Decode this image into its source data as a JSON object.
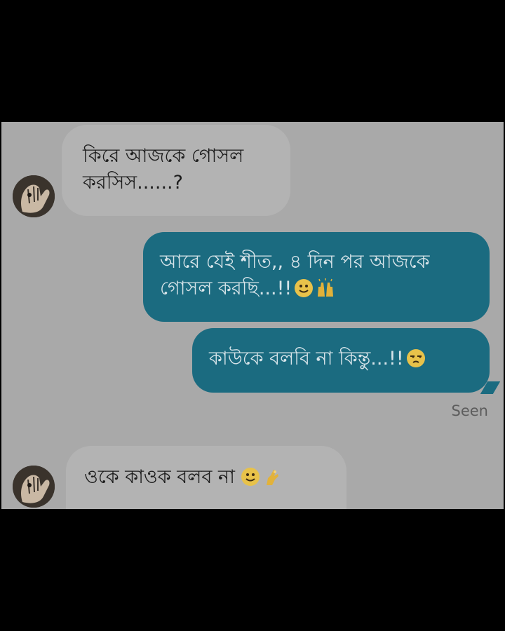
{
  "conversation": {
    "messages": [
      {
        "direction": "incoming",
        "text": "কিরে আজকে গোসল করসিস......?"
      },
      {
        "direction": "outgoing",
        "text": "আরে যেই শীত,, ৪ দিন পর আজকে গোসল করছি...!!",
        "emojis": [
          "slightly-smiling-face-icon",
          "raised-hands-icon"
        ]
      },
      {
        "direction": "outgoing",
        "text": "কাউকে বলবি না কিন্তু...!!",
        "emojis": [
          "unamused-face-icon"
        ]
      },
      {
        "direction": "incoming",
        "text": "ওকে কাওক বলব না",
        "emojis": [
          "slightly-smiling-face-icon",
          "pinching-hand-icon"
        ]
      }
    ],
    "seen_label": "Seen"
  },
  "colors": {
    "background": "#000000",
    "chat_background": "#a9a9a9",
    "incoming_bubble": "#b3b3b3",
    "outgoing_bubble": "#1b6b80",
    "outgoing_text": "#d7e4e9",
    "seen_text": "#5d5d5d"
  }
}
